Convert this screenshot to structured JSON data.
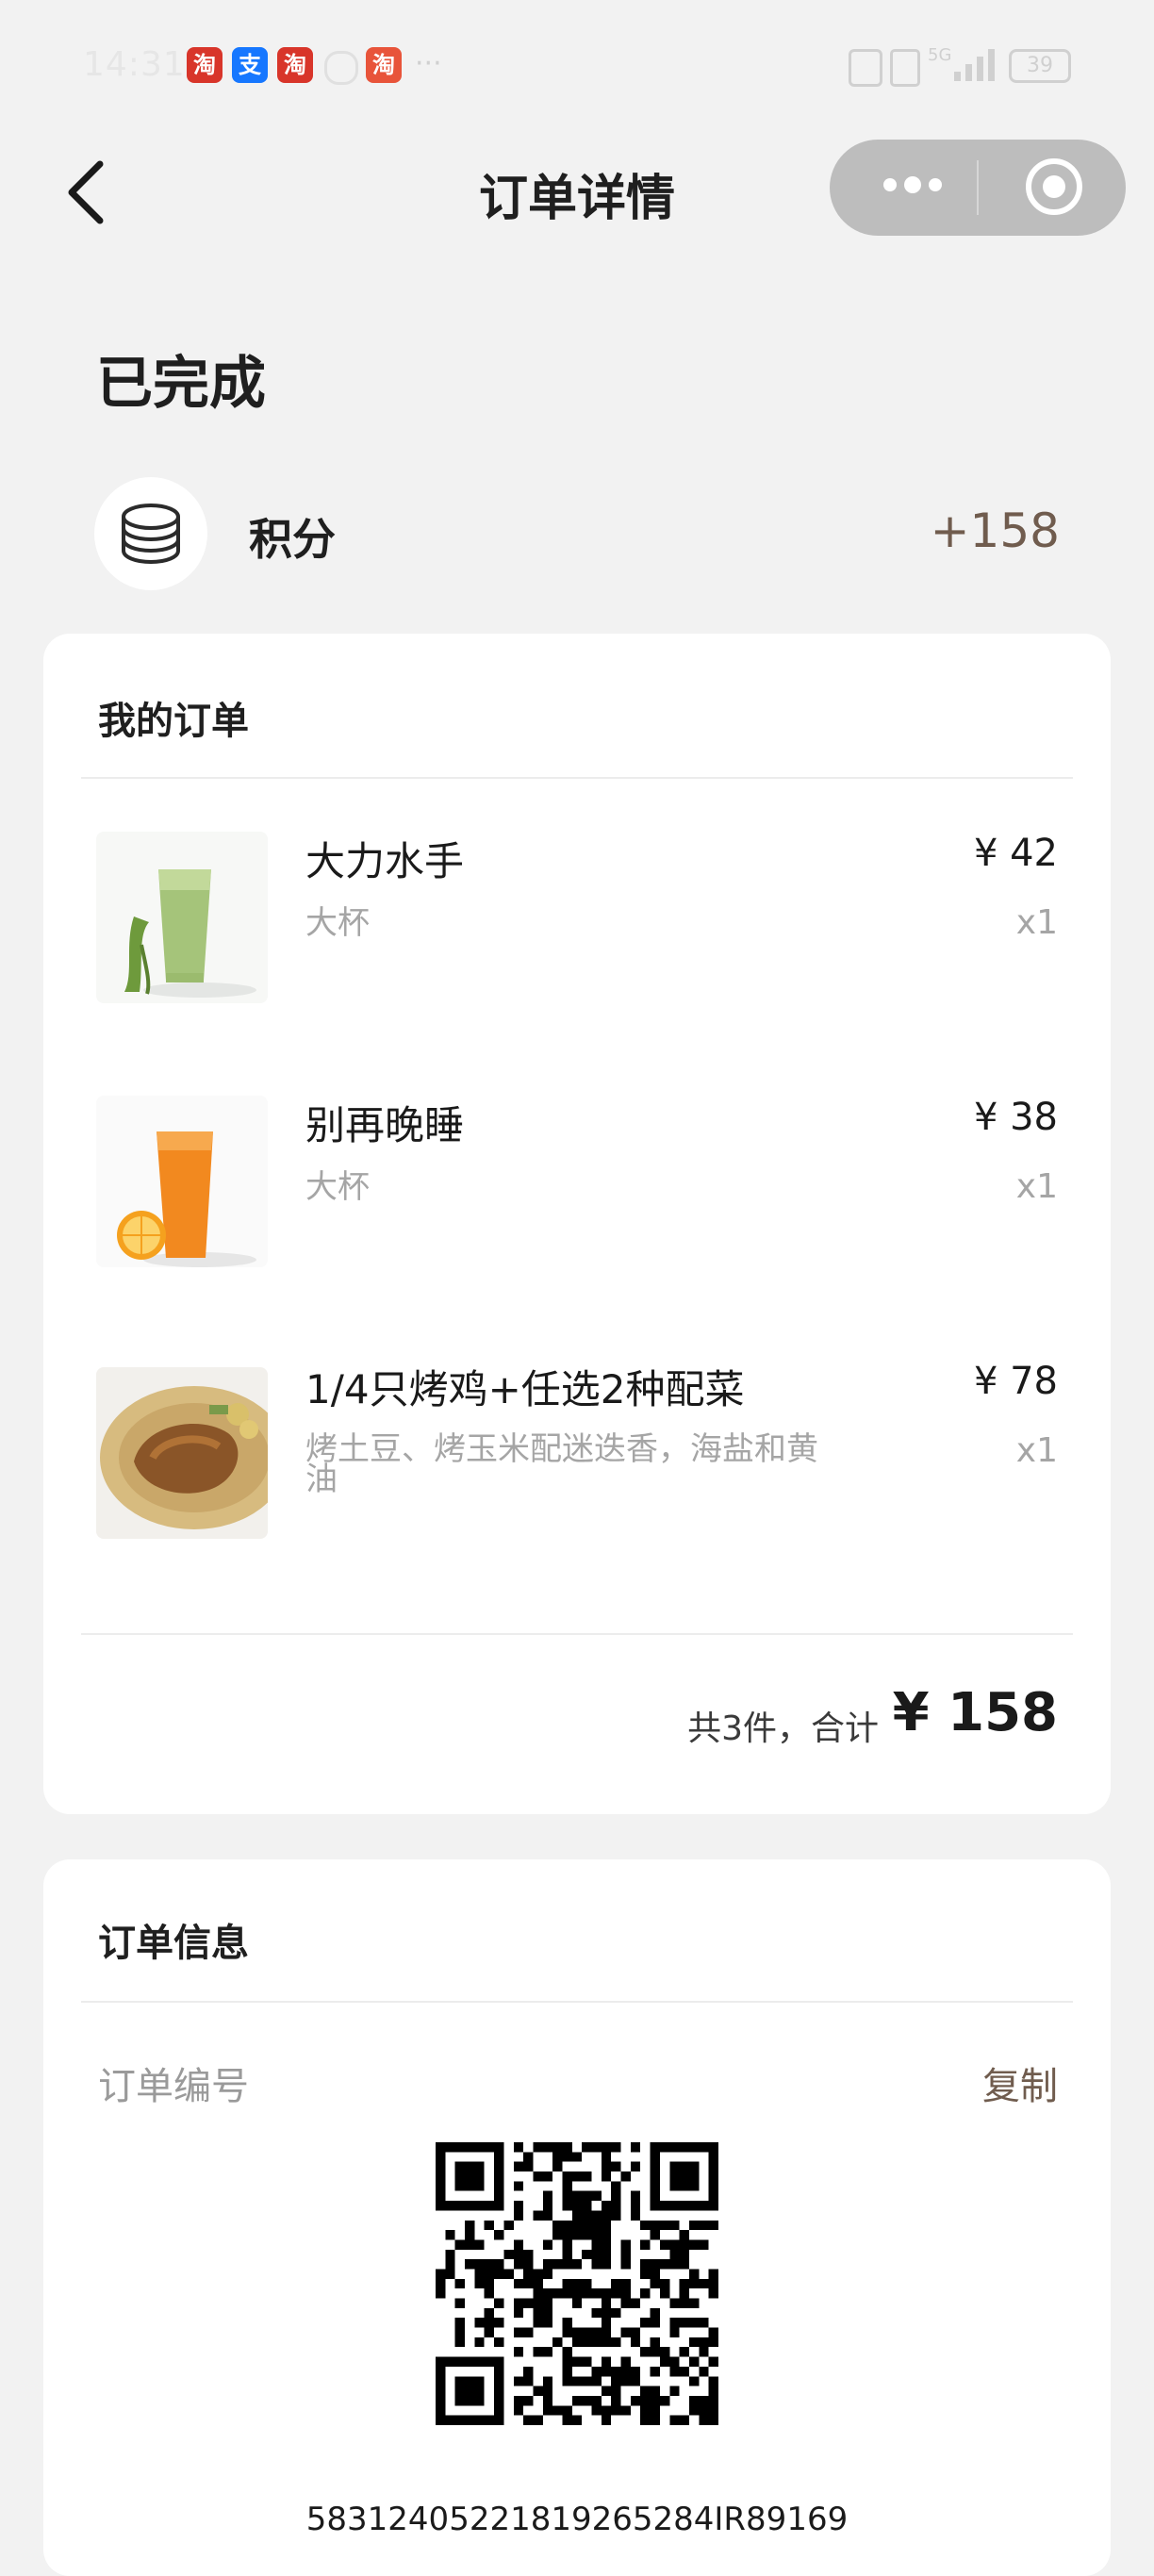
{
  "status_bar": {
    "time": "14:31",
    "app_badges": [
      {
        "label": "淘",
        "color": "#d8352a"
      },
      {
        "label": "支",
        "color": "#1677ff"
      },
      {
        "label": "淘",
        "color": "#d8352a"
      },
      {
        "label": "淘",
        "color": "#e8543a"
      }
    ],
    "more": "···",
    "network": "5G",
    "battery": "39"
  },
  "header": {
    "title": "订单详情"
  },
  "order_status": "已完成",
  "points": {
    "label": "积分",
    "value": "+158"
  },
  "my_order": {
    "title": "我的订单",
    "items": [
      {
        "name": "大力水手",
        "spec": "大杯",
        "price": "¥ 42",
        "qty": "x1",
        "image": "green-smoothie-image"
      },
      {
        "name": "别再晚睡",
        "spec": "大杯",
        "price": "¥ 38",
        "qty": "x1",
        "image": "orange-juice-image"
      },
      {
        "name": "1/4只烤鸡+任选2种配菜",
        "spec_line1": "烤土豆、烤玉米配迷迭香，海盐和黄",
        "spec_line2": "油",
        "price": "¥ 78",
        "qty": "x1",
        "image": "roast-chicken-image"
      }
    ],
    "summary_label": "共3件，合计",
    "summary_total": "¥ 158"
  },
  "order_info": {
    "title": "订单信息",
    "order_number_label": "订单编号",
    "copy_label": "复制",
    "order_number": "58312405221819265284IR89169"
  },
  "colors": {
    "accent_brown": "#705c4e",
    "page_bg": "#f2f2f2"
  }
}
